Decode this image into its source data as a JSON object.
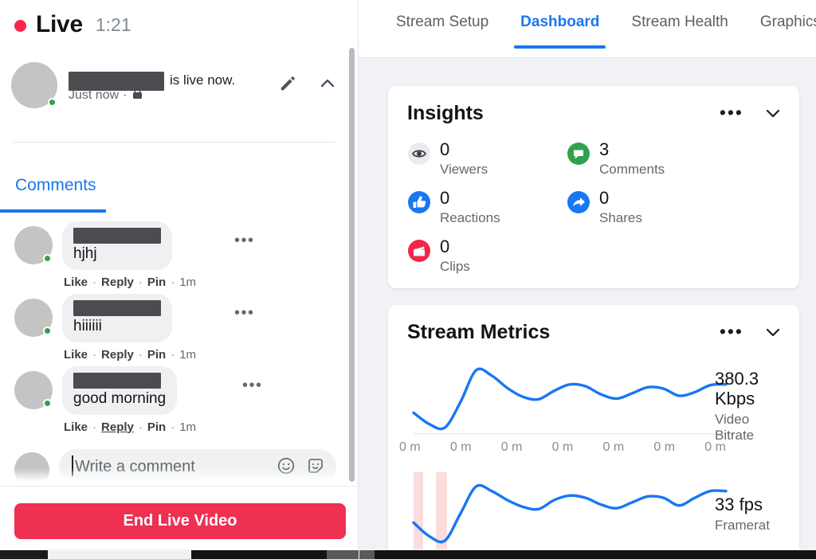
{
  "left_panel": {
    "live": {
      "label": "Live",
      "timer": "1:21",
      "dot_color": "#f5274e"
    },
    "post": {
      "author_redacted": true,
      "live_now_text": "is live now.",
      "timestamp": "Just now",
      "meta_separator": "·",
      "privacy_icon": "lock-icon",
      "edit_icon": "pencil-icon",
      "collapse_icon": "chevron-up-icon"
    },
    "tabs": {
      "comments_label": "Comments",
      "active": "Comments"
    },
    "comments": [
      {
        "name_redacted": true,
        "text": "hjhj",
        "like": "Like",
        "reply": "Reply",
        "pin": "Pin",
        "time": "1m",
        "hovered_action": ""
      },
      {
        "name_redacted": true,
        "text": "hiiiiii",
        "like": "Like",
        "reply": "Reply",
        "pin": "Pin",
        "time": "1m",
        "hovered_action": ""
      },
      {
        "name_redacted": true,
        "text": "good morning",
        "like": "Like",
        "reply": "Reply",
        "pin": "Pin",
        "time": "1m",
        "hovered_action": "Reply"
      }
    ],
    "composer": {
      "placeholder": "Write a comment",
      "emoji_icon": "emoji-smile-icon",
      "sticker_icon": "sticker-icon"
    },
    "footer": {
      "end_live_label": "End Live Video",
      "end_live_color": "#ee3051"
    }
  },
  "right_panel": {
    "tabs": [
      {
        "label": "Stream Setup",
        "active": false,
        "badge": false
      },
      {
        "label": "Dashboard",
        "active": true,
        "badge": false
      },
      {
        "label": "Stream Health",
        "active": false,
        "badge": false
      },
      {
        "label": "Graphics",
        "active": false,
        "badge": true
      }
    ],
    "insights": {
      "title": "Insights",
      "menu_icon": "more-options-icon",
      "collapse_icon": "chevron-down-icon",
      "stats": [
        {
          "value": "0",
          "label": "Viewers",
          "icon": "eye-icon",
          "color": "#e4e6eb"
        },
        {
          "value": "3",
          "label": "Comments",
          "icon": "comment-bubble-icon",
          "color": "#31a24c"
        },
        {
          "value": "0",
          "label": "Reactions",
          "icon": "thumbs-up-icon",
          "color": "#1877f2"
        },
        {
          "value": "0",
          "label": "Shares",
          "icon": "share-arrow-icon",
          "color": "#1877f2"
        },
        {
          "value": "0",
          "label": "Clips",
          "icon": "clapperboard-icon",
          "color": "#f0284a"
        }
      ]
    },
    "stream_metrics": {
      "title": "Stream Metrics",
      "menu_icon": "more-options-icon",
      "collapse_icon": "chevron-down-icon"
    }
  },
  "chart_data": [
    {
      "type": "line",
      "title": "Video Bitrate",
      "readout_value": "380.3",
      "readout_unit": "Kbps",
      "readout_label_line1": "Video",
      "readout_label_line2": "Bitrate",
      "xlabel": "",
      "ylabel": "Kbps",
      "grid": false,
      "legend": "none",
      "line_color": "#1877f2",
      "tick_labels": [
        "0 m",
        "0 m",
        "0 m",
        "0 m",
        "0 m",
        "0 m",
        "0 m"
      ],
      "x": [
        0,
        1,
        2,
        3,
        4,
        5,
        6,
        7,
        8,
        9,
        10,
        11,
        12,
        13,
        14,
        15,
        16,
        17,
        18,
        19,
        20
      ],
      "values": [
        300,
        268,
        258,
        330,
        420,
        405,
        370,
        345,
        338,
        362,
        380,
        375,
        352,
        340,
        355,
        372,
        368,
        348,
        358,
        378,
        380.3
      ]
    },
    {
      "type": "line",
      "title": "Framerate",
      "readout_value": "33",
      "readout_unit": "fps",
      "readout_label_line1": "Framerat",
      "readout_label_line2": "",
      "xlabel": "",
      "ylabel": "fps",
      "grid": false,
      "legend": "none",
      "line_color": "#1877f2",
      "alert_bands": 2,
      "alert_band_color": "#fbdddd",
      "x": [
        0,
        1,
        2,
        3,
        4,
        5,
        6,
        7,
        8,
        9,
        10,
        11,
        12,
        13,
        14,
        15,
        16,
        17,
        18,
        19,
        20
      ],
      "values": [
        26,
        23,
        22,
        28,
        34,
        33,
        31,
        29.5,
        29,
        31,
        32,
        31.5,
        30,
        29.2,
        30.5,
        31.8,
        31.5,
        29.8,
        31.5,
        33,
        33
      ]
    }
  ],
  "window_chrome": {
    "horizontal_scrollbar": true
  }
}
